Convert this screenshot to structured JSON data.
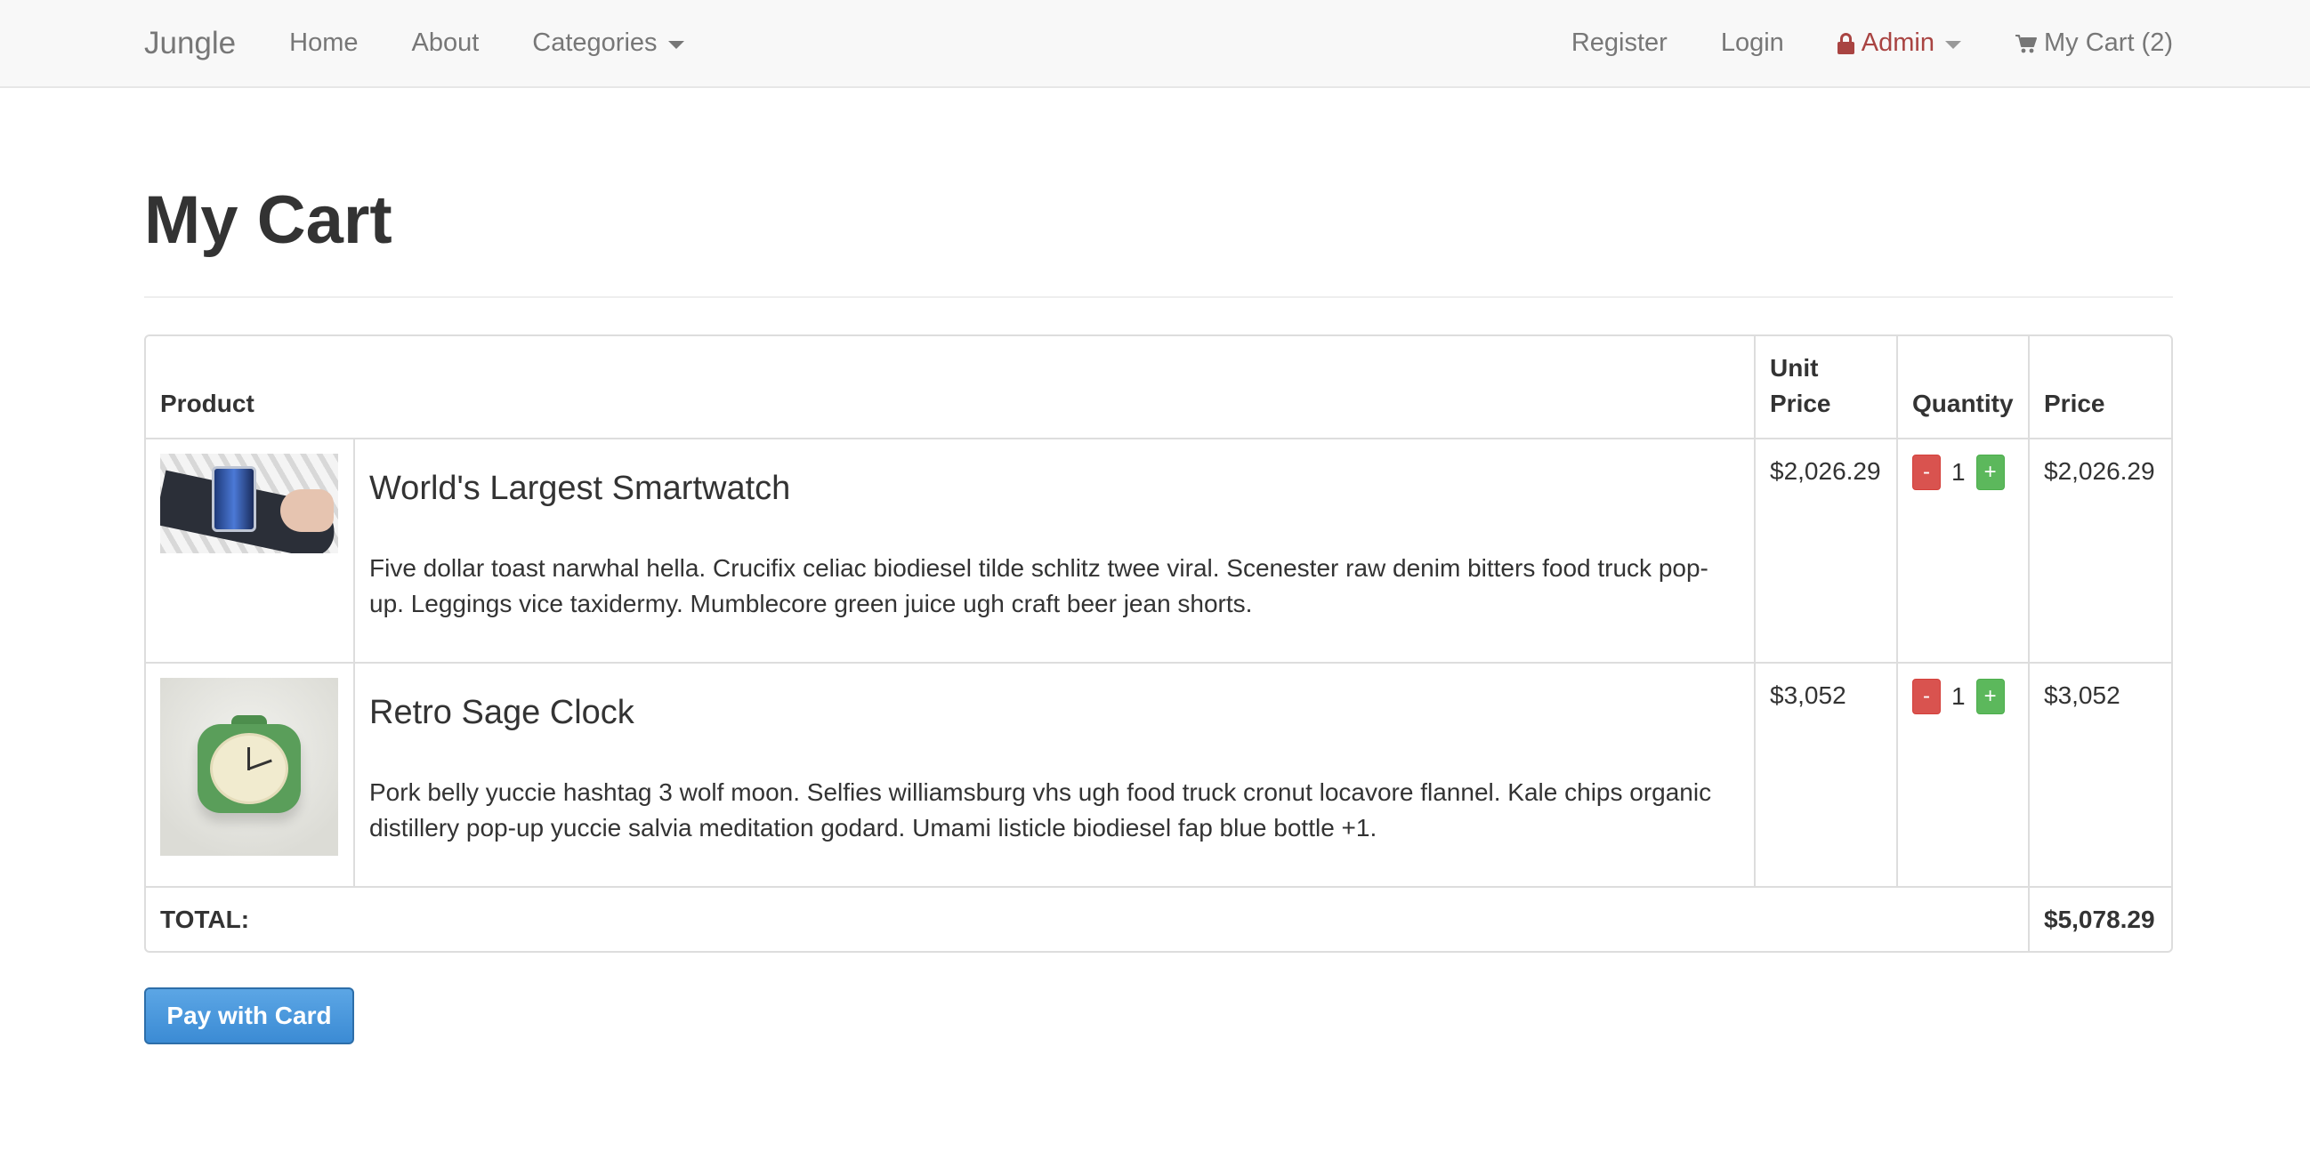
{
  "navbar": {
    "brand": "Jungle",
    "left_items": [
      "Home",
      "About",
      "Categories"
    ],
    "register": "Register",
    "login": "Login",
    "admin": "Admin",
    "cart": "My Cart (2)"
  },
  "page": {
    "title": "My Cart"
  },
  "table": {
    "headers": {
      "product": "Product",
      "unit_price": "Unit Price",
      "quantity": "Quantity",
      "price": "Price"
    },
    "rows": [
      {
        "name": "World's Largest Smartwatch",
        "description": "Five dollar toast narwhal hella. Crucifix celiac biodiesel tilde schlitz twee viral. Scenester raw denim bitters food truck pop-up. Leggings vice taxidermy. Mumblecore green juice ugh craft beer jean shorts.",
        "unit_price": "$2,026.29",
        "quantity": "1",
        "price": "$2,026.29"
      },
      {
        "name": "Retro Sage Clock",
        "description": "Pork belly yuccie hashtag 3 wolf moon. Selfies williamsburg vhs ugh food truck cronut locavore flannel. Kale chips organic distillery pop-up yuccie salvia meditation godard. Umami listicle biodiesel fap blue bottle +1.",
        "unit_price": "$3,052",
        "quantity": "1",
        "price": "$3,052"
      }
    ],
    "qty_minus": "-",
    "qty_plus": "+",
    "total_label": "TOTAL:",
    "total_value": "$5,078.29"
  },
  "pay_button": "Pay with Card",
  "colors": {
    "navbar_bg": "#f8f8f8",
    "admin_red": "#a94442",
    "minus_red": "#d9534f",
    "plus_green": "#5cb85c",
    "pay_blue": "#3b8bd4"
  },
  "icons": {
    "lock": "lock-icon",
    "cart": "cart-icon",
    "caret": "caret-down-icon"
  }
}
